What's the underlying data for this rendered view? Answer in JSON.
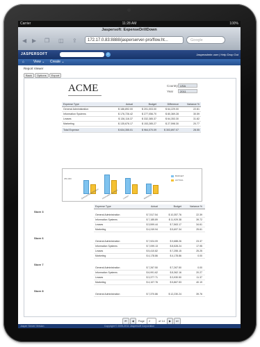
{
  "status": {
    "carrier": "Carrier",
    "time": "11:28 AM",
    "battery": "100%"
  },
  "browser": {
    "page_title": "Jaspersoft: ExpenseDrillDown",
    "url": "172.17.0.83:8888/jasperserver-pro/flow.ht...",
    "search_placeholder": "Google"
  },
  "app": {
    "brand": "JASPERSOFT",
    "user_text": "Jasperadmin user | Help Drop Out",
    "menu": {
      "home": "⌂",
      "view": "View ⌄",
      "create": "Create ⌄"
    }
  },
  "report": {
    "viewer_title": "Report Viewer",
    "tabs": [
      "Back",
      "Options",
      "Export"
    ],
    "company": "ACME",
    "country_label": "Country",
    "country_value": "USA",
    "year_label": "Year",
    "year_value": "2011",
    "summary_headers": [
      "Expense Type",
      "Actual",
      "Budget",
      "Difference",
      "Variance %"
    ],
    "summary_rows": [
      [
        "General Administration",
        "$ 186,892.00",
        "$ 201,003.00",
        "$ 64,229.00",
        "22.81"
      ],
      [
        "Information Systems",
        "$ 176,726.42",
        "$ 277,056.70",
        "$ 80,369.28",
        "30.59"
      ],
      [
        "Leases",
        "$ 136,116.37",
        "$ 332,385.37",
        "$ 64,353.30",
        "31.82"
      ],
      [
        "Marketing",
        "$ 135,676.17",
        "$ 153,285.27",
        "$ 27,598.30",
        "20.77"
      ]
    ],
    "summary_total": [
      "Total Expense",
      "$ 634,355.01",
      "$ 964,070.09",
      "$ 303,897.07",
      "28.55"
    ],
    "stores": [
      {
        "name": "Store 3",
        "rows": [
          [
            "General Administration",
            "$ 7,517.54",
            "$ 10,357.76",
            "22.39"
          ],
          [
            "Information Systems",
            "$ 7,185.89",
            "$ 11,929.38",
            "39.72"
          ],
          [
            "Leases",
            "$ 3,599.44",
            "$ 7,563.17",
            "34.61"
          ],
          [
            "Marketing",
            "$ 4,249.94",
            "$ 5,697.34",
            "25.61"
          ]
        ]
      },
      {
        "name": "Store 6",
        "rows": [
          [
            "General Administration",
            "$ 7,924.09",
            "$ 9,688.26",
            "23.37"
          ],
          [
            "Information Systems",
            "$ 7,099.13",
            "$ 8,528.24",
            "17.95"
          ],
          [
            "Leases",
            "$ 5,410.82",
            "$ 7,255.15",
            "25.25"
          ],
          [
            "Marketing",
            "$ 4,178.86",
            "$ 4,178.86",
            "0.00"
          ]
        ]
      },
      {
        "name": "Store 7",
        "rows": [
          [
            "General Administration",
            "$ 7,267.50",
            "$ 7,267.50",
            "0.00"
          ],
          [
            "Information Systems",
            "$ 6,991.62",
            "$ 8,362.16",
            "20.27"
          ],
          [
            "Leases",
            "$ 3,377.71",
            "$ 3,930.50",
            "11.37"
          ],
          [
            "Marketing",
            "$ 4,107.76",
            "$ 5,867.53",
            "40.19"
          ]
        ]
      },
      {
        "name": "Store 8",
        "rows": [
          [
            "General Administration",
            "$ 7,370.86",
            "$ 12,230.24",
            "39.76"
          ]
        ]
      }
    ],
    "detail_headers": [
      "Expense Type",
      "Actual",
      "Budget",
      "Variance %"
    ],
    "pager": {
      "first": "⏮",
      "prev": "◀",
      "page_label": "Page",
      "page_value": "2",
      "of_label": "of 14",
      "next": "▶",
      "last": "⏭"
    }
  },
  "chart_data": {
    "type": "bar",
    "categories": [
      "General Administration",
      "Information Systems",
      "Leases",
      "Marketing"
    ],
    "series": [
      {
        "name": "BUDGET",
        "values": [
          201003,
          277057,
          232385,
          153285
        ],
        "color": "#7fc3ef"
      },
      {
        "name": "ACTUAL",
        "values": [
          136892,
          196726,
          136116,
          125676
        ],
        "color": "#f5c132"
      }
    ],
    "ylim": [
      0,
      300000
    ],
    "yticks": [
      "250,000"
    ],
    "legend": "right"
  },
  "footer": {
    "left": "Jasper Server Version",
    "center": "Copyright © 2005-2011 Jaspersoft Corporation"
  }
}
